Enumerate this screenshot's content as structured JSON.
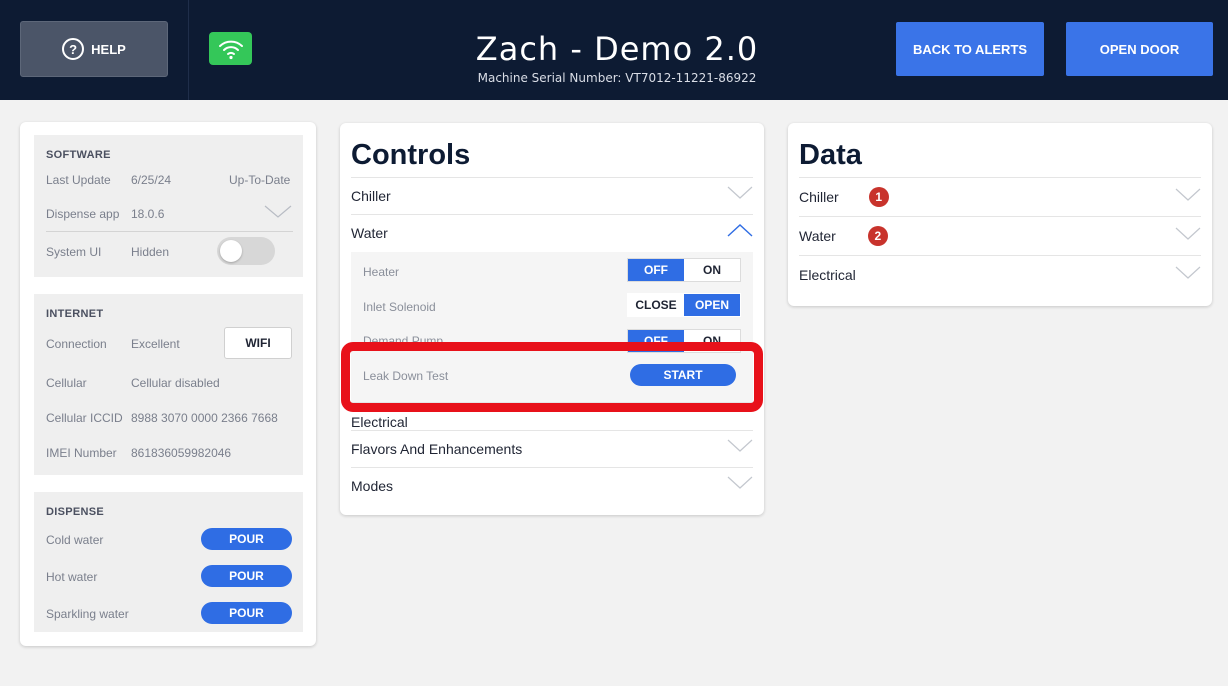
{
  "header": {
    "help_label": "HELP",
    "help_icon": "question-circle-icon",
    "wifi_icon": "wifi-icon",
    "title": "Zach - Demo 2.0",
    "serial": "Machine Serial Number: VT7012-11221-86922",
    "back_to_alerts": "BACK TO ALERTS",
    "open_door": "OPEN DOOR"
  },
  "software": {
    "title": "SOFTWARE",
    "last_update_label": "Last Update",
    "last_update_date": "6/25/24",
    "last_update_status": "Up-To-Date",
    "dispense_app_label": "Dispense app",
    "dispense_app_version": "18.0.6",
    "system_ui_label": "System UI",
    "system_ui_value": "Hidden"
  },
  "internet": {
    "title": "INTERNET",
    "connection_label": "Connection",
    "connection_value": "Excellent",
    "wifi_button": "WIFI",
    "cellular_label": "Cellular",
    "cellular_value": "Cellular disabled",
    "iccid_label": "Cellular ICCID",
    "iccid_value": "8988 3070 0000 2366 7668",
    "imei_label": "IMEI Number",
    "imei_value": "861836059982046"
  },
  "dispense": {
    "title": "DISPENSE",
    "items": [
      {
        "label": "Cold water",
        "button": "POUR"
      },
      {
        "label": "Hot water",
        "button": "POUR"
      },
      {
        "label": "Sparkling water",
        "button": "POUR"
      }
    ]
  },
  "controls": {
    "title": "Controls",
    "chiller": "Chiller",
    "water": "Water",
    "heater_label": "Heater",
    "heater_off": "OFF",
    "heater_on": "ON",
    "inlet_label": "Inlet Solenoid",
    "inlet_close": "CLOSE",
    "inlet_open": "OPEN",
    "demand_label": "Demand Pump",
    "demand_off": "OFF",
    "demand_on": "ON",
    "leak_label": "Leak Down Test",
    "leak_button": "START",
    "electrical": "Electrical",
    "flavors": "Flavors And Enhancements",
    "modes": "Modes"
  },
  "data_panel": {
    "title": "Data",
    "chiller": "Chiller",
    "chiller_badge": "1",
    "water": "Water",
    "water_badge": "2",
    "electrical": "Electrical"
  },
  "colors": {
    "header_bg": "#0d1b33",
    "accent": "#2f6de4",
    "highlight": "#e8111a",
    "badge": "#c8332c",
    "wifi_green": "#34c759"
  }
}
